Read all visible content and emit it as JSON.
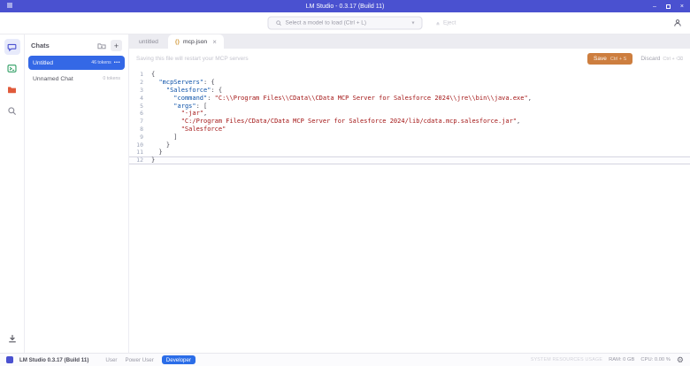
{
  "titlebar": {
    "title": "LM Studio - 0.3.17 (Build 11)",
    "minimize": "–",
    "close": "×"
  },
  "toolbar": {
    "model_select_label": "Select a model to load (Ctrl + L)",
    "chevron": "▾",
    "eject_label": "Eject"
  },
  "chats": {
    "header": "Chats",
    "items": [
      {
        "name": "Untitled",
        "meta": "46 tokens",
        "menu": "•••"
      },
      {
        "name": "Unnamed Chat",
        "meta": "0 tokens"
      }
    ]
  },
  "tabs": [
    {
      "label": "untitled"
    },
    {
      "icon": "{}",
      "label": "mcp.json",
      "close": "×"
    }
  ],
  "notification": {
    "message": "Saving this file will restart your MCP servers",
    "save_label": "Save",
    "save_hint": "Ctrl + S",
    "discard_label": "Discard",
    "discard_hint": "Ctrl + ⌫"
  },
  "editor": {
    "active_line": 12,
    "lines": [
      {
        "num": 1,
        "tokens": [
          {
            "c": "p",
            "t": "{"
          }
        ]
      },
      {
        "num": 2,
        "tokens": [
          {
            "c": "p",
            "t": "  "
          },
          {
            "c": "k",
            "t": "\"mcpServers\""
          },
          {
            "c": "p",
            "t": ": {"
          }
        ]
      },
      {
        "num": 3,
        "tokens": [
          {
            "c": "p",
            "t": "    "
          },
          {
            "c": "k",
            "t": "\"Salesforce\""
          },
          {
            "c": "p",
            "t": ": {"
          }
        ]
      },
      {
        "num": 4,
        "tokens": [
          {
            "c": "p",
            "t": "      "
          },
          {
            "c": "k",
            "t": "\"command\""
          },
          {
            "c": "p",
            "t": ": "
          },
          {
            "c": "s",
            "t": "\"C:\\\\Program Files\\\\CData\\\\CData MCP Server for Salesforce 2024\\\\jre\\\\bin\\\\java.exe\""
          },
          {
            "c": "p",
            "t": ","
          }
        ]
      },
      {
        "num": 5,
        "tokens": [
          {
            "c": "p",
            "t": "      "
          },
          {
            "c": "k",
            "t": "\"args\""
          },
          {
            "c": "p",
            "t": ": ["
          }
        ]
      },
      {
        "num": 6,
        "tokens": [
          {
            "c": "p",
            "t": "        "
          },
          {
            "c": "s",
            "t": "\"-jar\""
          },
          {
            "c": "p",
            "t": ","
          }
        ]
      },
      {
        "num": 7,
        "tokens": [
          {
            "c": "p",
            "t": "        "
          },
          {
            "c": "s",
            "t": "\"C:/Program Files/CData/CData MCP Server for Salesforce 2024/lib/cdata.mcp.salesforce.jar\""
          },
          {
            "c": "p",
            "t": ","
          }
        ]
      },
      {
        "num": 8,
        "tokens": [
          {
            "c": "p",
            "t": "        "
          },
          {
            "c": "s",
            "t": "\"Salesforce\""
          }
        ]
      },
      {
        "num": 9,
        "tokens": [
          {
            "c": "p",
            "t": "      ]"
          }
        ]
      },
      {
        "num": 10,
        "tokens": [
          {
            "c": "p",
            "t": "    }"
          }
        ]
      },
      {
        "num": 11,
        "tokens": [
          {
            "c": "p",
            "t": "  }"
          }
        ]
      },
      {
        "num": 12,
        "tokens": [
          {
            "c": "p",
            "t": "}"
          }
        ]
      }
    ]
  },
  "statusbar": {
    "version": "LM Studio 0.3.17 (Build 11)",
    "modes": [
      {
        "label": "User",
        "active": false
      },
      {
        "label": "Power User",
        "active": false
      },
      {
        "label": "Developer",
        "active": true
      }
    ],
    "resources_label": "SYSTEM RESOURCES USAGE",
    "ram": "RAM: 0 GB",
    "cpu": "CPU: 0.00 %",
    "gear": "⚙"
  },
  "colors": {
    "titlebar": "#4a51d0",
    "chat_selected": "#3468e6",
    "save_button": "#cd7e3f",
    "developer_badge": "#2b6de8"
  }
}
